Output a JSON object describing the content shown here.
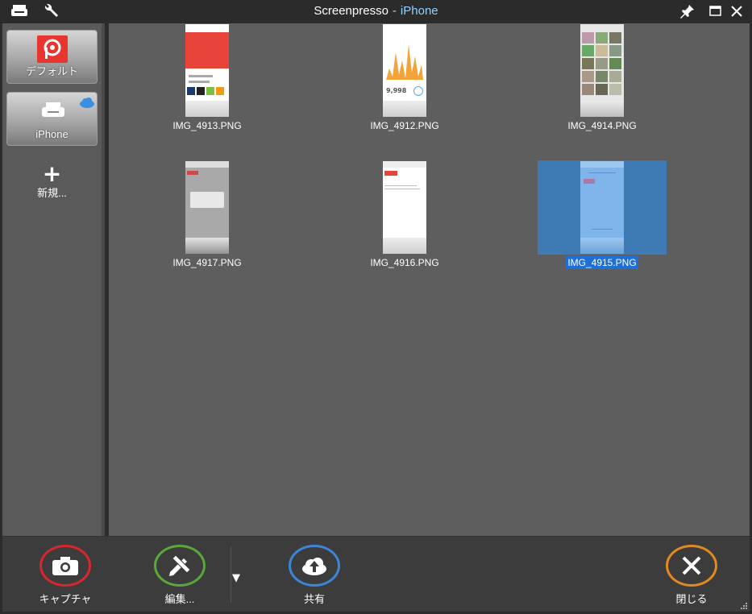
{
  "window": {
    "app_name": "Screenpresso",
    "separator": "-",
    "profile_name": "iPhone"
  },
  "sidebar": {
    "profiles": [
      {
        "label": "デフォルト",
        "icon": "screenpresso-logo-icon"
      },
      {
        "label": "iPhone",
        "icon": "printer-cloud-icon"
      }
    ],
    "new_label": "新規..."
  },
  "gallery": {
    "items": [
      {
        "name": "IMG_4913.PNG",
        "selected": false
      },
      {
        "name": "IMG_4912.PNG",
        "selected": false
      },
      {
        "name": "IMG_4914.PNG",
        "selected": false
      },
      {
        "name": "IMG_4917.PNG",
        "selected": false
      },
      {
        "name": "IMG_4916.PNG",
        "selected": false
      },
      {
        "name": "IMG_4915.PNG",
        "selected": true
      }
    ],
    "thumb_text": {
      "steps": "9,998"
    }
  },
  "toolbar": {
    "capture_label": "キャプチャ",
    "edit_label": "編集...",
    "share_label": "共有",
    "close_label": "閉じる",
    "dropdown_glyph": "▼"
  },
  "colors": {
    "capture_ring": "#d9262c",
    "edit_ring": "#5ba83a",
    "share_ring": "#3b86d6",
    "close_ring": "#e08a20",
    "selection": "#3e7ab4",
    "title_profile": "#8fd3ff"
  }
}
